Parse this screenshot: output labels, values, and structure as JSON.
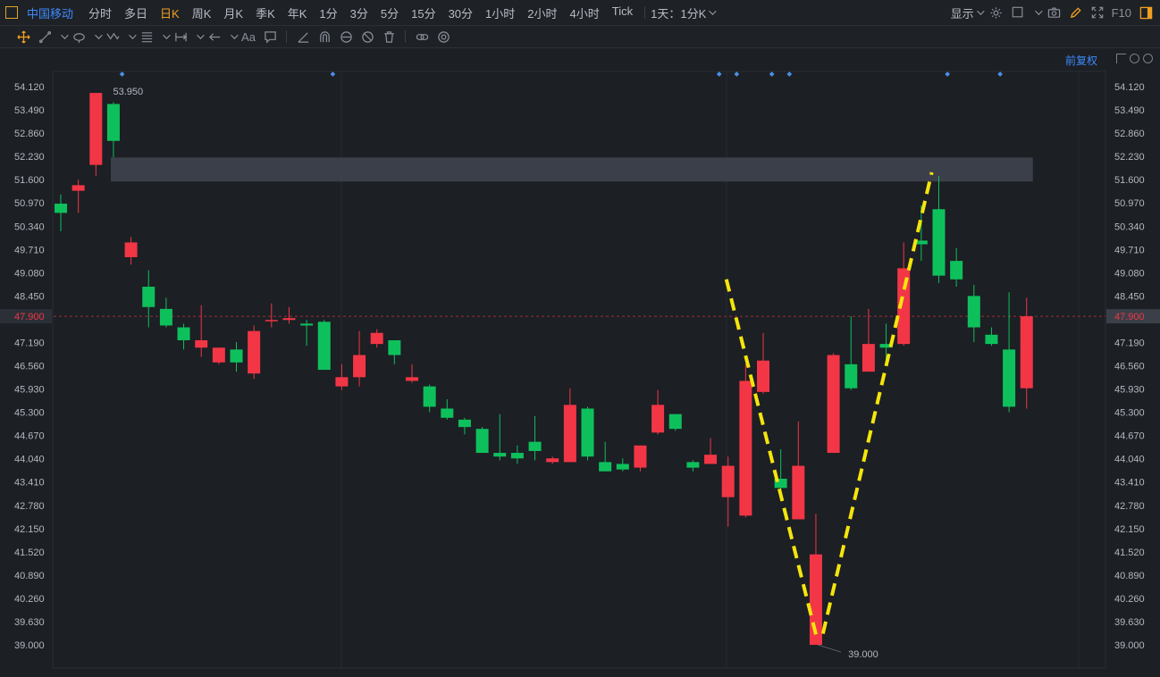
{
  "topbar": {
    "stock_name": "中国移动",
    "tabs": [
      "分时",
      "多日",
      "日K",
      "周K",
      "月K",
      "季K",
      "年K",
      "1分",
      "3分",
      "5分",
      "15分",
      "30分",
      "1小时",
      "2小时",
      "4小时",
      "Tick"
    ],
    "active_tab": "日K",
    "interval_selector": "1天：1分K",
    "display_label": "显示",
    "f10_label": "F10"
  },
  "chart_header": {
    "adjust_label": "前复权"
  },
  "colors": {
    "up": "#f23645",
    "down": "#0ec05c",
    "background": "#1c1f24",
    "annotation_line": "#f5e50b",
    "current_price": "#f23645",
    "zone": "#454b56"
  },
  "chart_data": {
    "type": "candlestick",
    "y_ticks": [
      "54.120",
      "53.490",
      "52.860",
      "52.230",
      "51.600",
      "50.970",
      "50.340",
      "49.710",
      "49.080",
      "48.450",
      "47.190",
      "46.560",
      "45.930",
      "45.300",
      "44.670",
      "44.040",
      "43.410",
      "42.780",
      "42.150",
      "41.520",
      "40.890",
      "40.260",
      "39.630",
      "39.000"
    ],
    "ylim": [
      39.0,
      54.12
    ],
    "current_price": "47.900",
    "max_label": "53.950",
    "min_label": "39.000",
    "resistance_zone": {
      "from_index": 3,
      "to_index": 55,
      "low": 51.55,
      "high": 52.2
    },
    "candles": [
      {
        "o": 50.95,
        "c": 50.7,
        "h": 51.2,
        "l": 50.2
      },
      {
        "o": 51.3,
        "c": 51.45,
        "h": 51.6,
        "l": 50.7
      },
      {
        "o": 52.0,
        "c": 53.95,
        "h": 53.95,
        "l": 51.7
      },
      {
        "o": 53.65,
        "c": 52.65,
        "h": 53.7,
        "l": 52.2
      },
      {
        "o": 49.5,
        "c": 49.9,
        "h": 50.05,
        "l": 49.3
      },
      {
        "o": 48.7,
        "c": 48.15,
        "h": 49.15,
        "l": 47.6
      },
      {
        "o": 48.1,
        "c": 47.65,
        "h": 48.4,
        "l": 47.6
      },
      {
        "o": 47.6,
        "c": 47.25,
        "h": 47.7,
        "l": 47.0
      },
      {
        "o": 47.05,
        "c": 47.25,
        "h": 48.2,
        "l": 46.8
      },
      {
        "o": 46.65,
        "c": 47.05,
        "h": 47.05,
        "l": 46.6
      },
      {
        "o": 47.0,
        "c": 46.65,
        "h": 47.2,
        "l": 46.4
      },
      {
        "o": 46.35,
        "c": 47.5,
        "h": 47.65,
        "l": 46.2
      },
      {
        "o": 47.8,
        "c": 47.8,
        "h": 48.25,
        "l": 47.6
      },
      {
        "o": 47.8,
        "c": 47.85,
        "h": 48.15,
        "l": 47.7
      },
      {
        "o": 47.7,
        "c": 47.65,
        "h": 47.8,
        "l": 47.1
      },
      {
        "o": 47.75,
        "c": 46.45,
        "h": 47.8,
        "l": 46.45
      },
      {
        "o": 46.0,
        "c": 46.25,
        "h": 46.6,
        "l": 45.9
      },
      {
        "o": 46.25,
        "c": 46.85,
        "h": 47.5,
        "l": 46.0
      },
      {
        "o": 47.15,
        "c": 47.45,
        "h": 47.55,
        "l": 47.05
      },
      {
        "o": 47.25,
        "c": 46.85,
        "h": 47.25,
        "l": 46.6
      },
      {
        "o": 46.15,
        "c": 46.25,
        "h": 46.6,
        "l": 46.1
      },
      {
        "o": 46.0,
        "c": 45.45,
        "h": 46.05,
        "l": 45.3
      },
      {
        "o": 45.4,
        "c": 45.15,
        "h": 45.65,
        "l": 45.1
      },
      {
        "o": 45.1,
        "c": 44.9,
        "h": 45.15,
        "l": 44.7
      },
      {
        "o": 44.85,
        "c": 44.2,
        "h": 44.9,
        "l": 44.2
      },
      {
        "o": 44.2,
        "c": 44.1,
        "h": 45.25,
        "l": 44.0
      },
      {
        "o": 44.2,
        "c": 44.05,
        "h": 44.4,
        "l": 43.9
      },
      {
        "o": 44.5,
        "c": 44.25,
        "h": 45.2,
        "l": 44.0
      },
      {
        "o": 43.95,
        "c": 44.05,
        "h": 44.1,
        "l": 43.9
      },
      {
        "o": 43.95,
        "c": 45.5,
        "h": 45.95,
        "l": 43.95
      },
      {
        "o": 45.4,
        "c": 44.1,
        "h": 45.45,
        "l": 44.0
      },
      {
        "o": 43.95,
        "c": 43.7,
        "h": 44.5,
        "l": 43.7
      },
      {
        "o": 43.9,
        "c": 43.75,
        "h": 44.05,
        "l": 43.7
      },
      {
        "o": 43.8,
        "c": 44.4,
        "h": 44.4,
        "l": 43.7
      },
      {
        "o": 44.75,
        "c": 45.5,
        "h": 45.9,
        "l": 44.7
      },
      {
        "o": 45.25,
        "c": 44.85,
        "h": 45.25,
        "l": 44.8
      },
      {
        "o": 43.95,
        "c": 43.8,
        "h": 44.0,
        "l": 43.7
      },
      {
        "o": 43.9,
        "c": 44.15,
        "h": 44.6,
        "l": 43.9
      },
      {
        "o": 43.0,
        "c": 43.85,
        "h": 44.1,
        "l": 42.2
      },
      {
        "o": 42.5,
        "c": 46.15,
        "h": 46.6,
        "l": 42.45
      },
      {
        "o": 45.85,
        "c": 46.7,
        "h": 47.45,
        "l": 45.8
      },
      {
        "o": 43.5,
        "c": 43.25,
        "h": 44.3,
        "l": 43.1
      },
      {
        "o": 42.4,
        "c": 43.85,
        "h": 45.05,
        "l": 42.4
      },
      {
        "o": 39.0,
        "c": 41.45,
        "h": 42.55,
        "l": 39.0
      },
      {
        "o": 44.2,
        "c": 46.85,
        "h": 46.9,
        "l": 44.2
      },
      {
        "o": 46.6,
        "c": 45.95,
        "h": 47.9,
        "l": 45.9
      },
      {
        "o": 46.4,
        "c": 47.15,
        "h": 48.1,
        "l": 46.4
      },
      {
        "o": 47.15,
        "c": 47.05,
        "h": 47.7,
        "l": 46.7
      },
      {
        "o": 47.15,
        "c": 49.2,
        "h": 49.9,
        "l": 47.1
      },
      {
        "o": 49.95,
        "c": 49.85,
        "h": 50.9,
        "l": 49.4
      },
      {
        "o": 50.8,
        "c": 49.0,
        "h": 51.7,
        "l": 48.8
      },
      {
        "o": 49.4,
        "c": 48.9,
        "h": 49.75,
        "l": 48.7
      },
      {
        "o": 48.45,
        "c": 47.6,
        "h": 48.75,
        "l": 47.2
      },
      {
        "o": 47.4,
        "c": 47.15,
        "h": 47.6,
        "l": 47.1
      },
      {
        "o": 47.0,
        "c": 45.45,
        "h": 48.55,
        "l": 45.3
      },
      {
        "o": 45.95,
        "c": 47.9,
        "h": 48.4,
        "l": 45.4
      }
    ],
    "event_marker_indices": [
      4,
      16,
      38,
      39,
      41,
      42,
      51,
      54
    ],
    "annotation_lines": [
      {
        "from": [
          37.9,
          48.9
        ],
        "to": [
          43.1,
          39.1
        ]
      },
      {
        "from": [
          43.4,
          39.3
        ],
        "to": [
          49.6,
          51.8
        ]
      }
    ]
  }
}
